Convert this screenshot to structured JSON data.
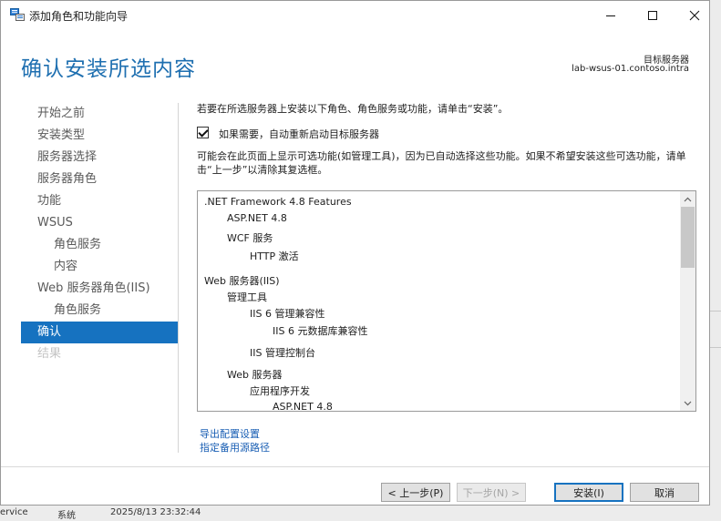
{
  "window": {
    "title": "添加角色和功能向导"
  },
  "header": {
    "page_title": "确认安装所选内容",
    "target_label": "目标服务器",
    "target_server": "lab-wsus-01.contoso.intra"
  },
  "sidebar": {
    "items": [
      {
        "label": "开始之前"
      },
      {
        "label": "安装类型"
      },
      {
        "label": "服务器选择"
      },
      {
        "label": "服务器角色"
      },
      {
        "label": "功能"
      },
      {
        "label": "WSUS"
      },
      {
        "label": "角色服务"
      },
      {
        "label": "内容"
      },
      {
        "label": "Web 服务器角色(IIS)"
      },
      {
        "label": "角色服务"
      },
      {
        "label": "确认"
      },
      {
        "label": "结果"
      }
    ]
  },
  "content": {
    "intro": "若要在所选服务器上安装以下角色、角色服务或功能，请单击“安装”。",
    "restart_checkbox_label": "如果需要，自动重新启动目标服务器",
    "restart_checked": true,
    "note": "可能会在此页面上显示可选功能(如管理工具)，因为已自动选择这些功能。如果不希望安装这些可选功能，请单击“上一步”以清除其复选框。",
    "features": [
      {
        "label": ".NET Framework 4.8 Features"
      },
      {
        "label": "ASP.NET 4.8"
      },
      {
        "label": "WCF 服务"
      },
      {
        "label": "HTTP 激活"
      },
      {
        "label": "Web 服务器(IIS)"
      },
      {
        "label": "管理工具"
      },
      {
        "label": "IIS 6 管理兼容性"
      },
      {
        "label": "IIS 6 元数据库兼容性"
      },
      {
        "label": "IIS 管理控制台"
      },
      {
        "label": "Web 服务器"
      },
      {
        "label": "应用程序开发"
      },
      {
        "label": "ASP.NET 4.8"
      }
    ],
    "export_link": "导出配置设置",
    "alt_source_link": "指定备用源路径"
  },
  "buttons": {
    "previous": "< 上一步(P)",
    "next": "下一步(N) >",
    "install": "安装(I)",
    "cancel": "取消"
  },
  "background": {
    "col1": "ervice",
    "col2": "系统",
    "col3": "2025/8/13 23:32:44"
  },
  "colors": {
    "accent": "#1672c0",
    "title": "#1e6fb0",
    "link": "#1a5fb4"
  }
}
